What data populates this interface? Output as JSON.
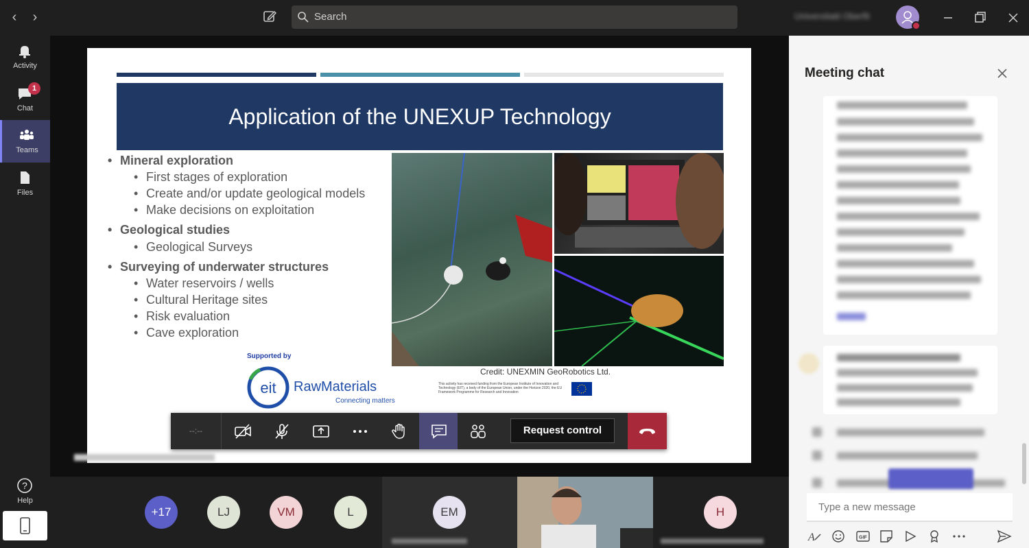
{
  "titlebar": {
    "search_placeholder": "Search",
    "org_name": "Universitatii Oberfit"
  },
  "rail": {
    "items": [
      {
        "label": "Activity"
      },
      {
        "label": "Chat",
        "badge": "1"
      },
      {
        "label": "Teams"
      },
      {
        "label": "Files"
      }
    ],
    "help_label": "Help"
  },
  "slide": {
    "title": "Application of the UNEXUP Technology",
    "bullets": [
      {
        "level": 1,
        "text": "Mineral exploration"
      },
      {
        "level": 2,
        "text": "First stages of exploration"
      },
      {
        "level": 2,
        "text": "Create and/or update geological models"
      },
      {
        "level": 2,
        "text": "Make decisions on exploitation"
      },
      {
        "level": 1,
        "text": "Geological studies"
      },
      {
        "level": 2,
        "text": "Geological Surveys"
      },
      {
        "level": 1,
        "text": "Surveying of underwater structures"
      },
      {
        "level": 2,
        "text": "Water reservoirs / wells"
      },
      {
        "level": 2,
        "text": "Cultural Heritage sites"
      },
      {
        "level": 2,
        "text": "Risk evaluation"
      },
      {
        "level": 2,
        "text": "Cave exploration"
      }
    ],
    "credit": "Credit: UNEXMIN GeoRobotics Ltd.",
    "supported_by": "Supported by",
    "eit_short": "eit",
    "brand": "RawMaterials",
    "tagline": "Connecting matters",
    "eu_funding": "This activity has received funding from the European Institute of Innovation and Technology (EIT), a body of the European Union, under the Horizon 2020, the EU Framework Programme for Research and Innovation",
    "colors": {
      "title_bg": "#1f3864",
      "bar1": "#1f3864",
      "bar2": "#4a90a8",
      "bar3": "#e6e6e6"
    }
  },
  "controls": {
    "timer": "--:--",
    "request_control": "Request control",
    "icons": [
      "camera-off-icon",
      "mic-off-icon",
      "share-screen-icon",
      "more-icon",
      "raise-hand-icon",
      "chat-icon",
      "participants-icon",
      "hang-up-icon"
    ]
  },
  "participants": {
    "overflow": "+17",
    "avatars": [
      {
        "initials": "LJ",
        "color": "#dfe5d6",
        "text": "#3b3b3b"
      },
      {
        "initials": "VM",
        "color": "#f2d4d6",
        "text": "#8a2a35"
      },
      {
        "initials": "L",
        "color": "#e2ead7",
        "text": "#3b3b3b"
      }
    ],
    "em_initials": "EM",
    "h_initials": "H"
  },
  "chat": {
    "title": "Meeting chat",
    "compose_placeholder": "Type a new message"
  }
}
